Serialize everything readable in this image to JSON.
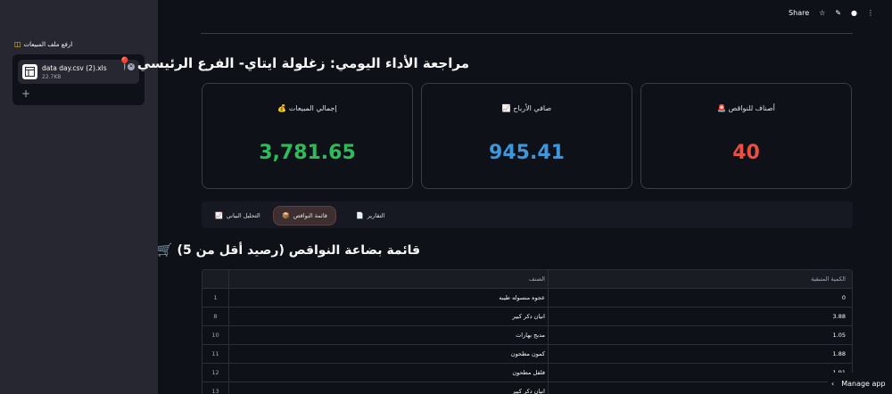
{
  "sidebar": {
    "uploader_label": "ارفع ملف المبيعات",
    "file": {
      "name": "data day.csv (2).xls",
      "size": "22.7KB"
    }
  },
  "header": {
    "share": "Share"
  },
  "page": {
    "title": "مراجعة الأداء اليومي: زغلولة ايتاي- الفرع الرئيسي"
  },
  "metrics": [
    {
      "label": "أصناف للنواقص",
      "value": "40",
      "color": "#ea4f44",
      "icon": "alarm-icon"
    },
    {
      "label": "صافي الأرباح",
      "value": "945.41",
      "color": "#3d97db",
      "icon": "chart-up-icon"
    },
    {
      "label": "إجمالي المبيعات",
      "value": "3,781.65",
      "color": "#2ebc5a",
      "icon": "money-bag-icon"
    }
  ],
  "tabs": [
    {
      "label": "التقارير",
      "active": false
    },
    {
      "label": "قائمة النواقص",
      "active": true
    },
    {
      "label": "التحليل البياني",
      "active": false
    }
  ],
  "section": {
    "title": "قائمة بضاعة النواقص (رصيد أقل من 5)"
  },
  "table": {
    "columns": [
      "الصنف",
      "الكمية المتبقية"
    ],
    "rows": [
      {
        "index": "1",
        "name": "عجوه منسوله طيبه",
        "qty": "0"
      },
      {
        "index": "8",
        "name": "انيان دكر كبير",
        "qty": "3.88"
      },
      {
        "index": "10",
        "name": "مدبج بهارات",
        "qty": "1.05"
      },
      {
        "index": "11",
        "name": "كمون مطحون",
        "qty": "1.88"
      },
      {
        "index": "12",
        "name": "فلفل مطحون",
        "qty": "1.91"
      },
      {
        "index": "13",
        "name": "انيان دكر كبير",
        "qty": ""
      }
    ]
  },
  "footer": {
    "manage_app": "Manage app"
  }
}
